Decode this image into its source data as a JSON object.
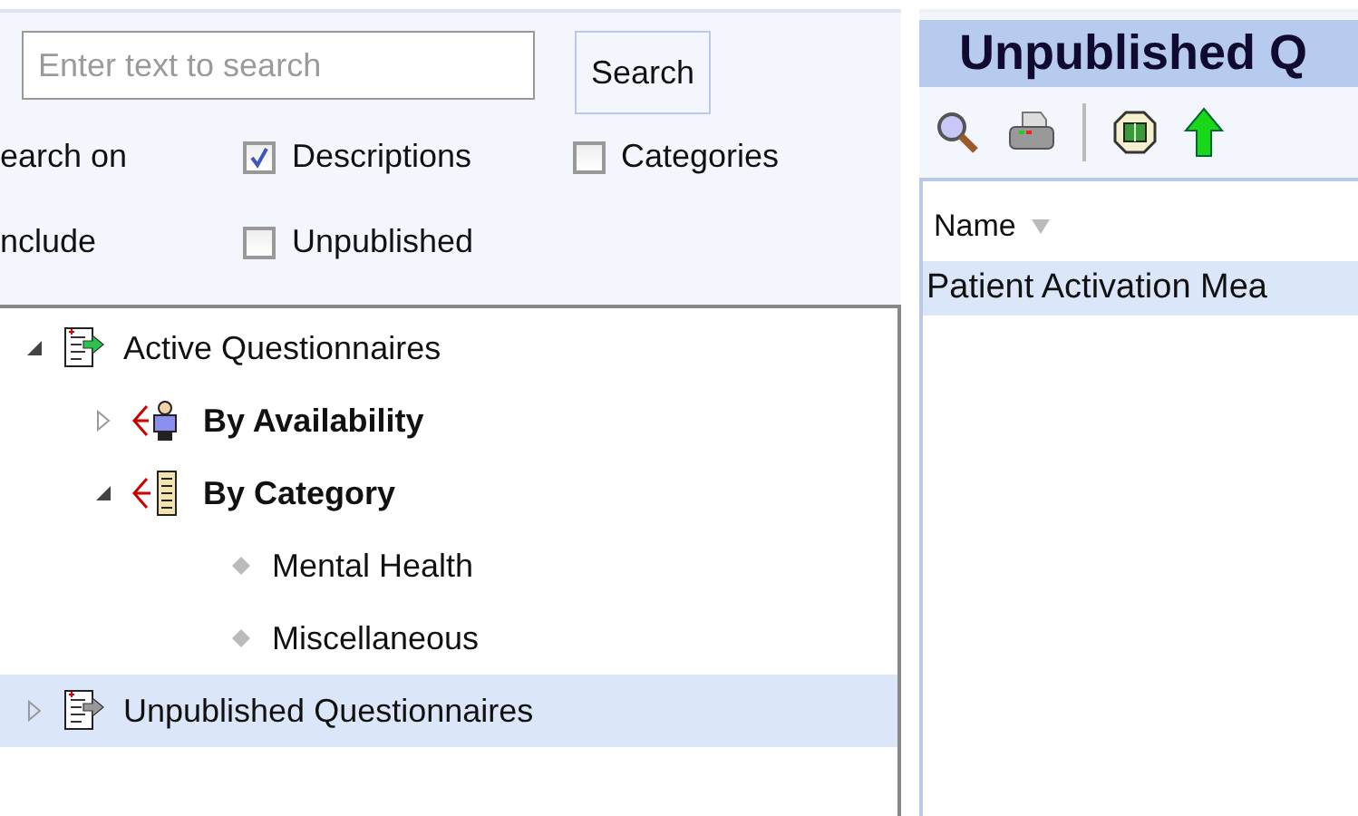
{
  "search": {
    "placeholder": "Enter text to search",
    "button": "Search"
  },
  "options": [
    {
      "label": "earch on",
      "checks": [
        {
          "label": "Descriptions",
          "checked": true
        },
        {
          "label": "Categories",
          "checked": false
        }
      ]
    },
    {
      "label": "nclude",
      "checks": [
        {
          "label": "Unpublished",
          "checked": false
        }
      ]
    }
  ],
  "tree": [
    {
      "label": "Active Questionnaires",
      "kind": "questionnaire",
      "bold": false,
      "expanded": true,
      "selected": false,
      "children": [
        {
          "label": "By Availability",
          "kind": "availability",
          "bold": true,
          "expanded": false,
          "selected": false
        },
        {
          "label": "By Category",
          "kind": "category",
          "bold": true,
          "expanded": true,
          "selected": false,
          "children": [
            {
              "label": "Mental Health",
              "kind": "leaf",
              "bold": false,
              "selected": false
            },
            {
              "label": "Miscellaneous",
              "kind": "leaf",
              "bold": false,
              "selected": false
            }
          ]
        }
      ]
    },
    {
      "label": "Unpublished Questionnaires",
      "kind": "questionnaire-gray",
      "bold": false,
      "expanded": false,
      "selected": true
    }
  ],
  "panel": {
    "title": "Unpublished Q",
    "toolbar": [
      {
        "kind": "search"
      },
      {
        "kind": "printer"
      },
      {
        "kind": "separator"
      },
      {
        "kind": "box"
      },
      {
        "kind": "arrow-up"
      }
    ],
    "columns": [
      {
        "label": "Name",
        "sorted": true
      }
    ],
    "rows": [
      {
        "name": "Patient Activation Mea",
        "selected": true
      }
    ]
  }
}
